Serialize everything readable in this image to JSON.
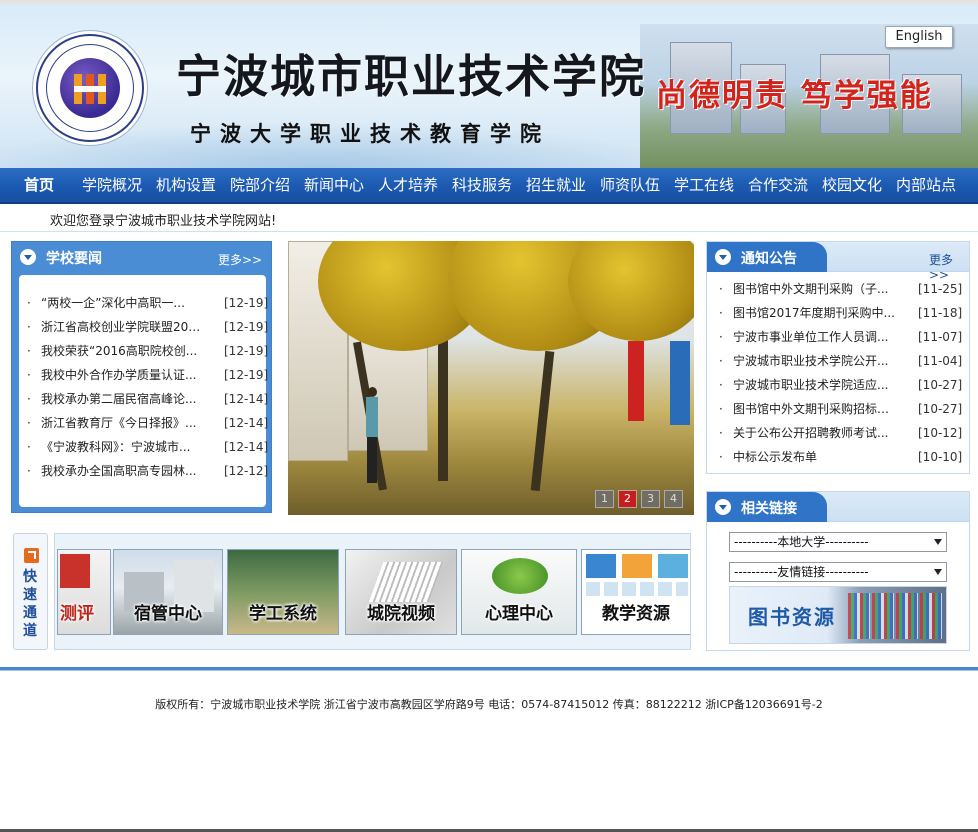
{
  "header": {
    "school_name": "宁波城市职业技术学院",
    "school_subname": "宁波大学职业技术教育学院",
    "motto": "尚德明责 笃学强能",
    "english_label": "English"
  },
  "nav": {
    "items": [
      "首页",
      "学院概况",
      "机构设置",
      "院部介绍",
      "新闻中心",
      "人才培养",
      "科技服务",
      "招生就业",
      "师资队伍",
      "学工在线",
      "合作交流",
      "校园文化",
      "内部站点"
    ]
  },
  "welcome": "欢迎您登录宁波城市职业技术学院网站!",
  "school_news": {
    "title": "学校要闻",
    "more": "更多>>",
    "items": [
      {
        "text": "“两校一企”深化中高职一...",
        "date": "[12-19]"
      },
      {
        "text": "浙江省高校创业学院联盟201...",
        "date": "[12-19]"
      },
      {
        "text": "我校荣获“2016高职院校创...",
        "date": "[12-19]"
      },
      {
        "text": "我校中外合作办学质量认证...",
        "date": "[12-19]"
      },
      {
        "text": "我校承办第二届民宿高峰论...",
        "date": "[12-14]"
      },
      {
        "text": "浙江省教育厅《今日择报》...",
        "date": "[12-14]"
      },
      {
        "text": "《宁波教科网》：宁波城市...",
        "date": "[12-14]"
      },
      {
        "text": "我校承办全国高职高专园林...",
        "date": "[12-12]"
      }
    ]
  },
  "slideshow": {
    "pages": [
      "1",
      "2",
      "3",
      "4"
    ],
    "active": "2"
  },
  "notices": {
    "title": "通知公告",
    "more": "更多>>",
    "items": [
      {
        "text": "图书馆中外文期刊采购（子...",
        "date": "[11-25]"
      },
      {
        "text": "图书馆2017年度期刊采购中...",
        "date": "[11-18]"
      },
      {
        "text": "宁波市事业单位工作人员调...",
        "date": "[11-07]"
      },
      {
        "text": "宁波城市职业技术学院公开...",
        "date": "[11-04]"
      },
      {
        "text": "宁波城市职业技术学院适应...",
        "date": "[10-27]"
      },
      {
        "text": "图书馆中外文期刊采购招标公告",
        "date": "[10-27]"
      },
      {
        "text": "关于公布公开招聘教师考试...",
        "date": "[10-12]"
      },
      {
        "text": "中标公示发布单",
        "date": "[10-10]"
      }
    ]
  },
  "links": {
    "title": "相关链接",
    "select_local": "----------本地大学----------",
    "select_friend": "----------友情链接----------",
    "library_label": "图书资源"
  },
  "quick_access": {
    "label": "快速通道",
    "items": [
      "测评",
      "宿管中心",
      "学工系统",
      "城院视频",
      "心理中心",
      "教学资源"
    ]
  },
  "footer": "版权所有：宁波城市职业技术学院 浙江省宁波市高教园区学府路9号 电话：0574-87415012 传真：88122212 浙ICP备12036691号-2"
}
